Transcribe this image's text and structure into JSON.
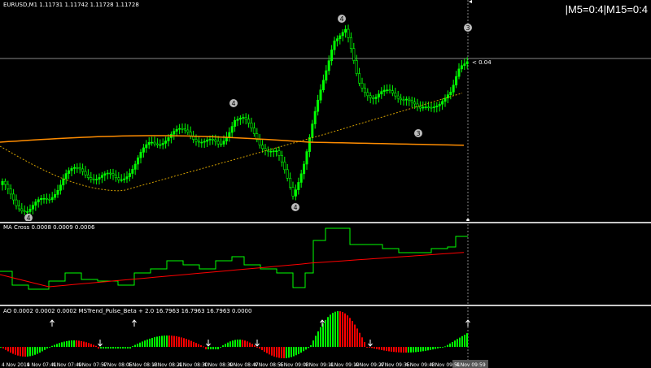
{
  "main": {
    "symbol_info": "EURUSD,M1  1.11731 1.11742 1.11728 1.11728",
    "tf_status": "|M5=0:4|M15=0:4",
    "price_label": "< 0.04",
    "wave_labels": [
      "4",
      "4",
      "4",
      "4",
      "3",
      "3"
    ]
  },
  "ma_cross": {
    "label": "MA Cross 0.0008 0.0009 0.0006"
  },
  "ao": {
    "label": "AO 0.0002 0.0002 0.0002  MSTrend_Pulse_Beta + 2.0 16.7963 16.7963 16.7963 0.0000"
  },
  "time_axis": {
    "labels": [
      "4 Nov 2019",
      "4 Nov 07:41",
      "4 Nov 07:49",
      "4 Nov 07:57",
      "4 Nov 08:05",
      "4 Nov 08:13",
      "4 Nov 08:21",
      "4 Nov 08:30",
      "4 Nov 08:39",
      "4 Nov 08:47",
      "4 Nov 08:55",
      "4 Nov 09:03",
      "4 Nov 09:11",
      "4 Nov 09:19",
      "4 Nov 09:27",
      "4 Nov 09:35",
      "4 Nov 09:43",
      "4 Nov 09:51",
      "4 Nov 09:59"
    ]
  },
  "colors": {
    "bull": "#00ff00",
    "bear": "#ff0000",
    "orange": "#ff8c00",
    "green_line": "#00ff00",
    "red_line": "#ff0000"
  }
}
